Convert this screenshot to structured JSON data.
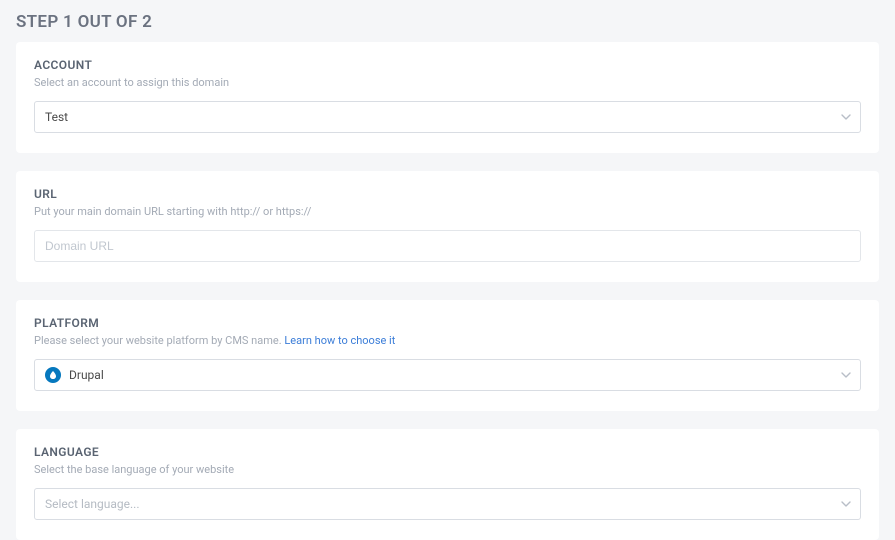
{
  "page": {
    "title": "STEP 1 OUT OF 2"
  },
  "account": {
    "label": "ACCOUNT",
    "help": "Select an account to assign this domain",
    "value": "Test"
  },
  "url": {
    "label": "URL",
    "help": "Put your main domain URL starting with http:// or https://",
    "placeholder": "Domain URL"
  },
  "platform": {
    "label": "PLATFORM",
    "help_prefix": "Please select your website platform by CMS name.  ",
    "help_link_text": "Learn how to choose it",
    "value": "Drupal"
  },
  "language": {
    "label": "LANGUAGE",
    "help": "Select the base language of your website",
    "placeholder": "Select language..."
  }
}
